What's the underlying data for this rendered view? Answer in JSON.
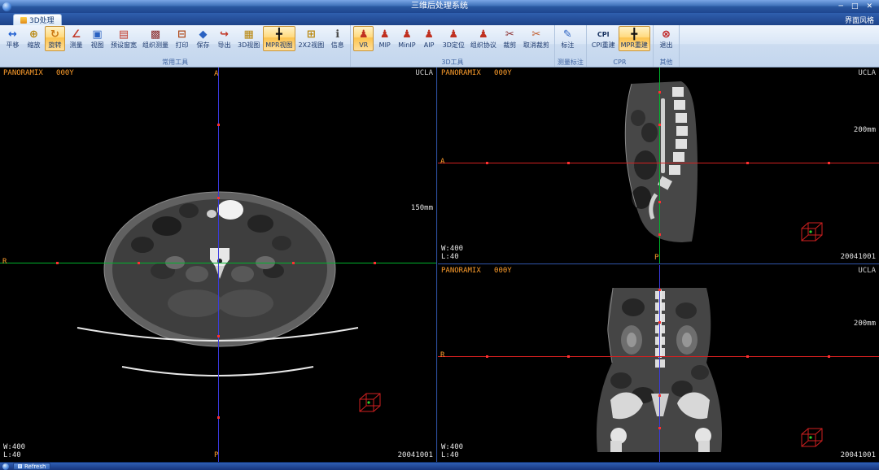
{
  "titlebar": {
    "title": "三维后处理系统",
    "minimize": "─",
    "maximize": "□",
    "close": "✕"
  },
  "tabs": {
    "active": "3D处理",
    "style_menu": "界面风格"
  },
  "ribbon": {
    "groups": [
      {
        "label": "常用工具",
        "buttons": [
          {
            "name": "pan",
            "label": "平移",
            "glyph": "↔",
            "color": "#1f5fd0"
          },
          {
            "name": "zoom",
            "label": "缩放",
            "glyph": "⊕",
            "color": "#b8860b"
          },
          {
            "name": "rotate",
            "label": "旋转",
            "glyph": "↻",
            "color": "#cc7a14",
            "active": true
          },
          {
            "name": "measure",
            "label": "测量",
            "glyph": "∠",
            "color": "#c23a2a"
          },
          {
            "name": "view",
            "label": "视图",
            "glyph": "▣",
            "color": "#2a62c2"
          },
          {
            "name": "window-preset",
            "label": "预设窗宽",
            "glyph": "▤",
            "color": "#c23a2a"
          },
          {
            "name": "tissue-measure",
            "label": "组织测量",
            "glyph": "▩",
            "color": "#8a2a2a"
          },
          {
            "name": "print",
            "label": "打印",
            "glyph": "⊟",
            "color": "#b04a1a"
          },
          {
            "name": "save",
            "label": "保存",
            "glyph": "◆",
            "color": "#2a62c2"
          },
          {
            "name": "export",
            "label": "导出",
            "glyph": "↪",
            "color": "#c23a2a"
          },
          {
            "name": "3d-view",
            "label": "3D视图",
            "glyph": "▦",
            "color": "#b8860b"
          },
          {
            "name": "mpr-view",
            "label": "MPR视图",
            "glyph": "╋",
            "color": "#111111",
            "active": true
          },
          {
            "name": "2x2-view",
            "label": "2X2视图",
            "glyph": "⊞",
            "color": "#b8860b"
          },
          {
            "name": "info",
            "label": "信息",
            "glyph": "ℹ",
            "color": "#4a4a4a"
          }
        ]
      },
      {
        "label": "3D工具",
        "buttons": [
          {
            "name": "vr",
            "label": "VR",
            "glyph": "♟",
            "color": "#c03020",
            "active": true
          },
          {
            "name": "mip",
            "label": "MIP",
            "glyph": "♟",
            "color": "#c03020"
          },
          {
            "name": "minip",
            "label": "MinIP",
            "glyph": "♟",
            "color": "#c03020"
          },
          {
            "name": "aip",
            "label": "AIP",
            "glyph": "♟",
            "color": "#c03020"
          },
          {
            "name": "3d-locate",
            "label": "3D定位",
            "glyph": "♟",
            "color": "#c03020"
          },
          {
            "name": "tissue-protocol",
            "label": "组织协议",
            "glyph": "♟",
            "color": "#c03020"
          },
          {
            "name": "crop",
            "label": "裁剪",
            "glyph": "✂",
            "color": "#8a2a2a"
          },
          {
            "name": "uncrop",
            "label": "取消裁剪",
            "glyph": "✂",
            "color": "#c05a2a"
          }
        ]
      },
      {
        "label": "测量标注",
        "buttons": [
          {
            "name": "annotate",
            "label": "标注",
            "glyph": "✎",
            "color": "#2a62c2"
          }
        ]
      },
      {
        "label": "CPR",
        "buttons": [
          {
            "name": "cpr-rebuild",
            "label": "CPI重建",
            "glyph": "CPI",
            "color": "#16305e",
            "text_icon": true
          },
          {
            "name": "mpr-rebuild",
            "label": "MPR重建",
            "glyph": "╋",
            "color": "#111111",
            "active": true
          }
        ]
      },
      {
        "label": "其他",
        "buttons": [
          {
            "name": "exit",
            "label": "退出",
            "glyph": "⊗",
            "color": "#c02020"
          }
        ]
      }
    ]
  },
  "viewports": {
    "axial": {
      "patient": "PANORAMIX",
      "code": "000Y",
      "site": "UCLA",
      "scale": "150mm",
      "window_width": "W:400",
      "window_level": "L:40",
      "date": "20041001",
      "orientation": {
        "top": "A",
        "left": "R",
        "bottom": "P"
      }
    },
    "sagittal": {
      "patient": "PANORAMIX",
      "code": "000Y",
      "site": "UCLA",
      "scale": "200mm",
      "window_width": "W:400",
      "window_level": "L:40",
      "date": "20041001",
      "orientation": {
        "left": "A",
        "bottom": "P"
      }
    },
    "coronal": {
      "patient": "PANORAMIX",
      "code": "000Y",
      "site": "UCLA",
      "scale": "200mm",
      "window_width": "W:400",
      "window_level": "L:40",
      "date": "20041001",
      "orientation": {
        "left": "R"
      }
    }
  },
  "statusbar": {
    "task": "Refresh"
  },
  "colors": {
    "crosshair_blue": "#3a3adf",
    "crosshair_green": "#00b42c",
    "crosshair_red": "#d42020",
    "accent_orange": "#ff9e2c"
  }
}
